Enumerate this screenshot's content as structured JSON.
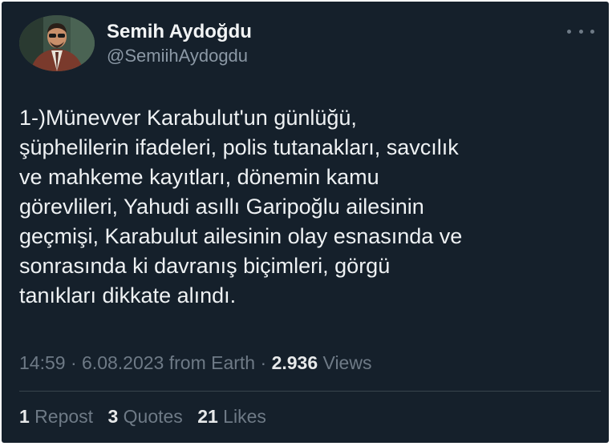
{
  "author": {
    "display_name": "Semih Aydoğdu",
    "handle": "@SemiihAydogdu"
  },
  "tweet": {
    "text": "1-)Münevver Karabulut'un günlüğü,\nşüphelilerin ifadeleri, polis tutanakları, savcılık\nve mahkeme kayıtları, dönemin kamu\ngörevlileri, Yahudi asıllı Garipoğlu ailesinin\ngeçmişi, Karabulut ailesinin olay esnasında ve\nsonrasında ki davranış biçimleri, görgü\ntanıkları dikkate alındı."
  },
  "meta": {
    "time": "14:59",
    "sep1": " · ",
    "date": "6.08.2023",
    "source": " from Earth",
    "sep2": " · ",
    "views_count": "2.936",
    "views_label": " Views"
  },
  "stats": {
    "reposts_count": "1",
    "reposts_label": " Repost",
    "quotes_count": "3",
    "quotes_label": " Quotes",
    "likes_count": "21",
    "likes_label": " Likes"
  },
  "icons": {
    "more": "more-horizontal-icon"
  },
  "colors": {
    "background": "#15202b",
    "primary_text": "#e7e9ea",
    "secondary_text": "#6e7a86",
    "divider": "#38444d"
  }
}
